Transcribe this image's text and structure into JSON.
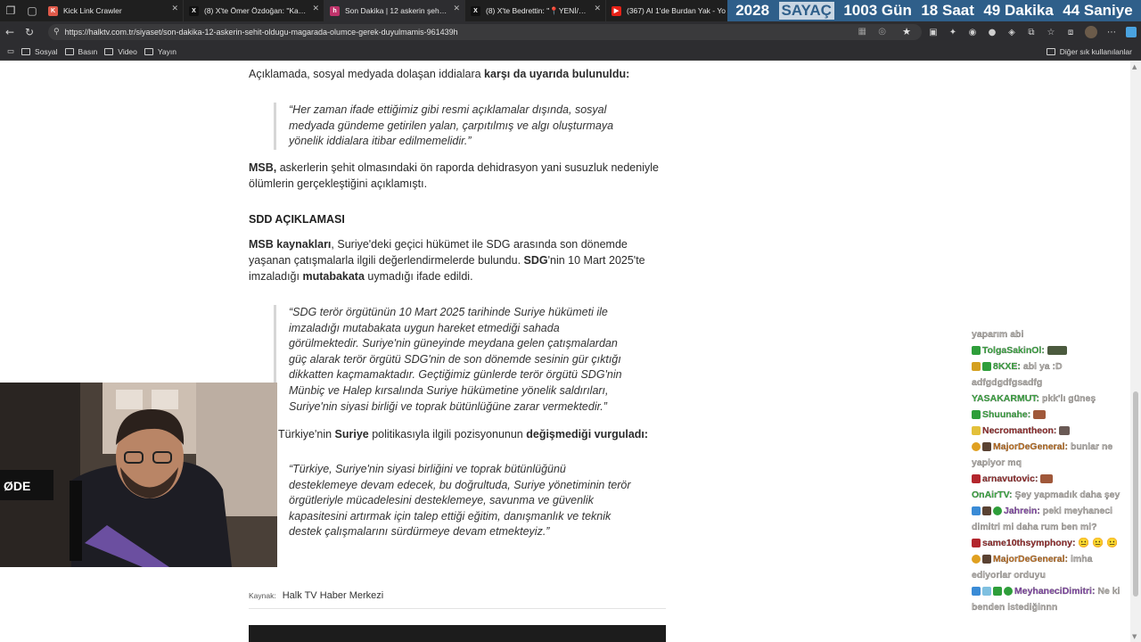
{
  "browser": {
    "tabs": [
      {
        "title": "Kick Link Crawler",
        "favicon_color": "#e05a4a",
        "active": false
      },
      {
        "title": "(8) X'te Ömer Özdoğan: \"Kamuoy",
        "favicon_color": "#111111",
        "active": false
      },
      {
        "title": "Son Dakika | 12 askerin şehit oldu",
        "favicon_color": "#c0336b",
        "active": true
      },
      {
        "title": "(8) X'te Bedrettin: \"📍YENİ/ÖNEM",
        "favicon_color": "#111111",
        "active": false
      },
      {
        "title": "(367) AI 1'de Burdan Yak - Yo",
        "favicon_color": "#e62117",
        "active": false
      }
    ],
    "url": "https://halktv.com.tr/siyaset/son-dakika-12-askerin-sehit-oldugu-magarada-olumce-gerek-duyulmamis-961439h",
    "bookmarks": [
      "Sosyal",
      "Basın",
      "Video",
      "Yayın"
    ],
    "other_bookmarks": "Diğer sık kullanılanlar"
  },
  "countdown": {
    "year": "2028",
    "label": "SAYAÇ",
    "days": "1003 Gün",
    "hours": "18 Saat",
    "minutes": "49 Dakika",
    "seconds": "44 Saniye"
  },
  "article": {
    "p1": "Açıklamada, sosyal medyada dolaşan iddialara ",
    "p1_bold": "karşı da uyarıda bulunuldu:",
    "quote1_l1": "“Her zaman ifade ettiğimiz gibi resmi açıklamalar dışında, sosyal",
    "quote1_l2": "medyada gündeme getirilen yalan, çarpıtılmış ve algı oluşturmaya",
    "quote1_l3": "yönelik iddialara itibar edilmemelidir.”",
    "p2_bold": "MSB,",
    "p2_l1": " askerlerin şehit olmasındaki ön raporda dehidrasyon yani susuzluk nedeniyle",
    "p2_l2": "ölümlerin gerçekleştiğini açıklamıştı.",
    "heading": "SDD AÇIKLAMASI",
    "p3_b1": "MSB kaynakları",
    "p3_t1": ", Suriye'deki geçici hükümet ile SDG arasında son dönemde",
    "p3_t2": "yaşanan çatışmalarla ilgili değerlendirmelerde bulundu. ",
    "p3_b2": "SDG",
    "p3_t3": "'nin 10 Mart 2025'te",
    "p3_t4": "imzaladığı ",
    "p3_b3": "mutabakata",
    "p3_t5": " uymadığı ifade edildi.",
    "quote2": [
      "“SDG terör örgütünün 10 Mart 2025 tarihinde Suriye hükümeti ile",
      "imzaladığı mutabakata uygun hareket etmediği sahada",
      "görülmektedir. Suriye'nin güneyinde meydana gelen çatışmalardan",
      "güç alarak terör örgütü SDG'nin de son dönemde sesinin gür çıktığı",
      "dikkatten kaçmamaktadır. Geçtiğimiz günlerde terör örgütü SDG'nin",
      "Münbiç ve Halep kırsalında Suriye hükümetine yönelik saldırıları,",
      "Suriye'nin siyasi birliği ve toprak bütünlüğüne zarar vermektedir.”"
    ],
    "p4_t1": "Türkiye'nin ",
    "p4_b1": "Suriye",
    "p4_t2": " politikasıyla ilgili pozisyonunun ",
    "p4_b2": "değişmediği vurguladı:",
    "quote3": [
      "“Türkiye, Suriye'nin siyasi birliğini ve toprak bütünlüğünü",
      "desteklemeye devam edecek, bu doğrultuda, Suriye yönetiminin terör",
      "örgütleriyle mücadelesini desteklemeye, savunma ve güvenlik",
      "kapasitesini artırmak için talep ettiği eğitim, danışmanlık ve teknik",
      "destek çalışmalarını sürdürmeye devam etmekteyiz.”"
    ],
    "source_label": "Kaynak:",
    "source_value": "Halk TV Haber Merkezi"
  },
  "webcam": {
    "mic_brand": "ØDE"
  },
  "chat": {
    "messages": [
      {
        "user": "",
        "color": "#b7b2ad",
        "text": "yaparım abi",
        "badge": ""
      },
      {
        "user": "TolgaSakinOl:",
        "color": "#3cb043",
        "text": "",
        "badge": "#2e9e3a",
        "emote": true
      },
      {
        "user": "8KXE:",
        "color": "#3cb043",
        "text": "abi ya :D adfgdgdfgsadfg",
        "badge": "#d4a020"
      },
      {
        "user": "YASAKARMUT:",
        "color": "#3cb043",
        "text": "pkk'lı güneş",
        "badge": ""
      },
      {
        "user": "Shuunahe:",
        "color": "#3cb043",
        "text": "",
        "badge": "#2e9e3a",
        "emote": true
      },
      {
        "user": "Necromantheon:",
        "color": "#9a2b2b",
        "text": "",
        "badge": "#e3c03a",
        "emote": true
      },
      {
        "user": "MajorDeGeneral:",
        "color": "#c8731f",
        "text": "bunlar ne yapiyor mq",
        "badge": "#e0a020"
      },
      {
        "user": "arnavutovic:",
        "color": "#9a2b2b",
        "text": "",
        "badge": "#b3262d",
        "emote": true
      },
      {
        "user": "OnAirTV:",
        "color": "#3cb043",
        "text": "Şey yapmadık daha şey",
        "badge": ""
      },
      {
        "user": "Jahrein:",
        "color": "#8a4ab0",
        "text": "peki meyhaneci dimitri mi daha rum ben mi?",
        "badge": "#3a8bd6"
      },
      {
        "user": "same10thsymphony:",
        "color": "#9a2b2b",
        "text": "😐 😐 😐",
        "badge": "#b3262d"
      },
      {
        "user": "MajorDeGeneral:",
        "color": "#c8731f",
        "text": "imha ediyorlar orduyu",
        "badge": "#e0a020"
      },
      {
        "user": "MeyhaneciDimitri:",
        "color": "#8a4ab0",
        "text": "Ne ki benden istediğinnn",
        "badge": "#3a8bd6"
      }
    ]
  }
}
